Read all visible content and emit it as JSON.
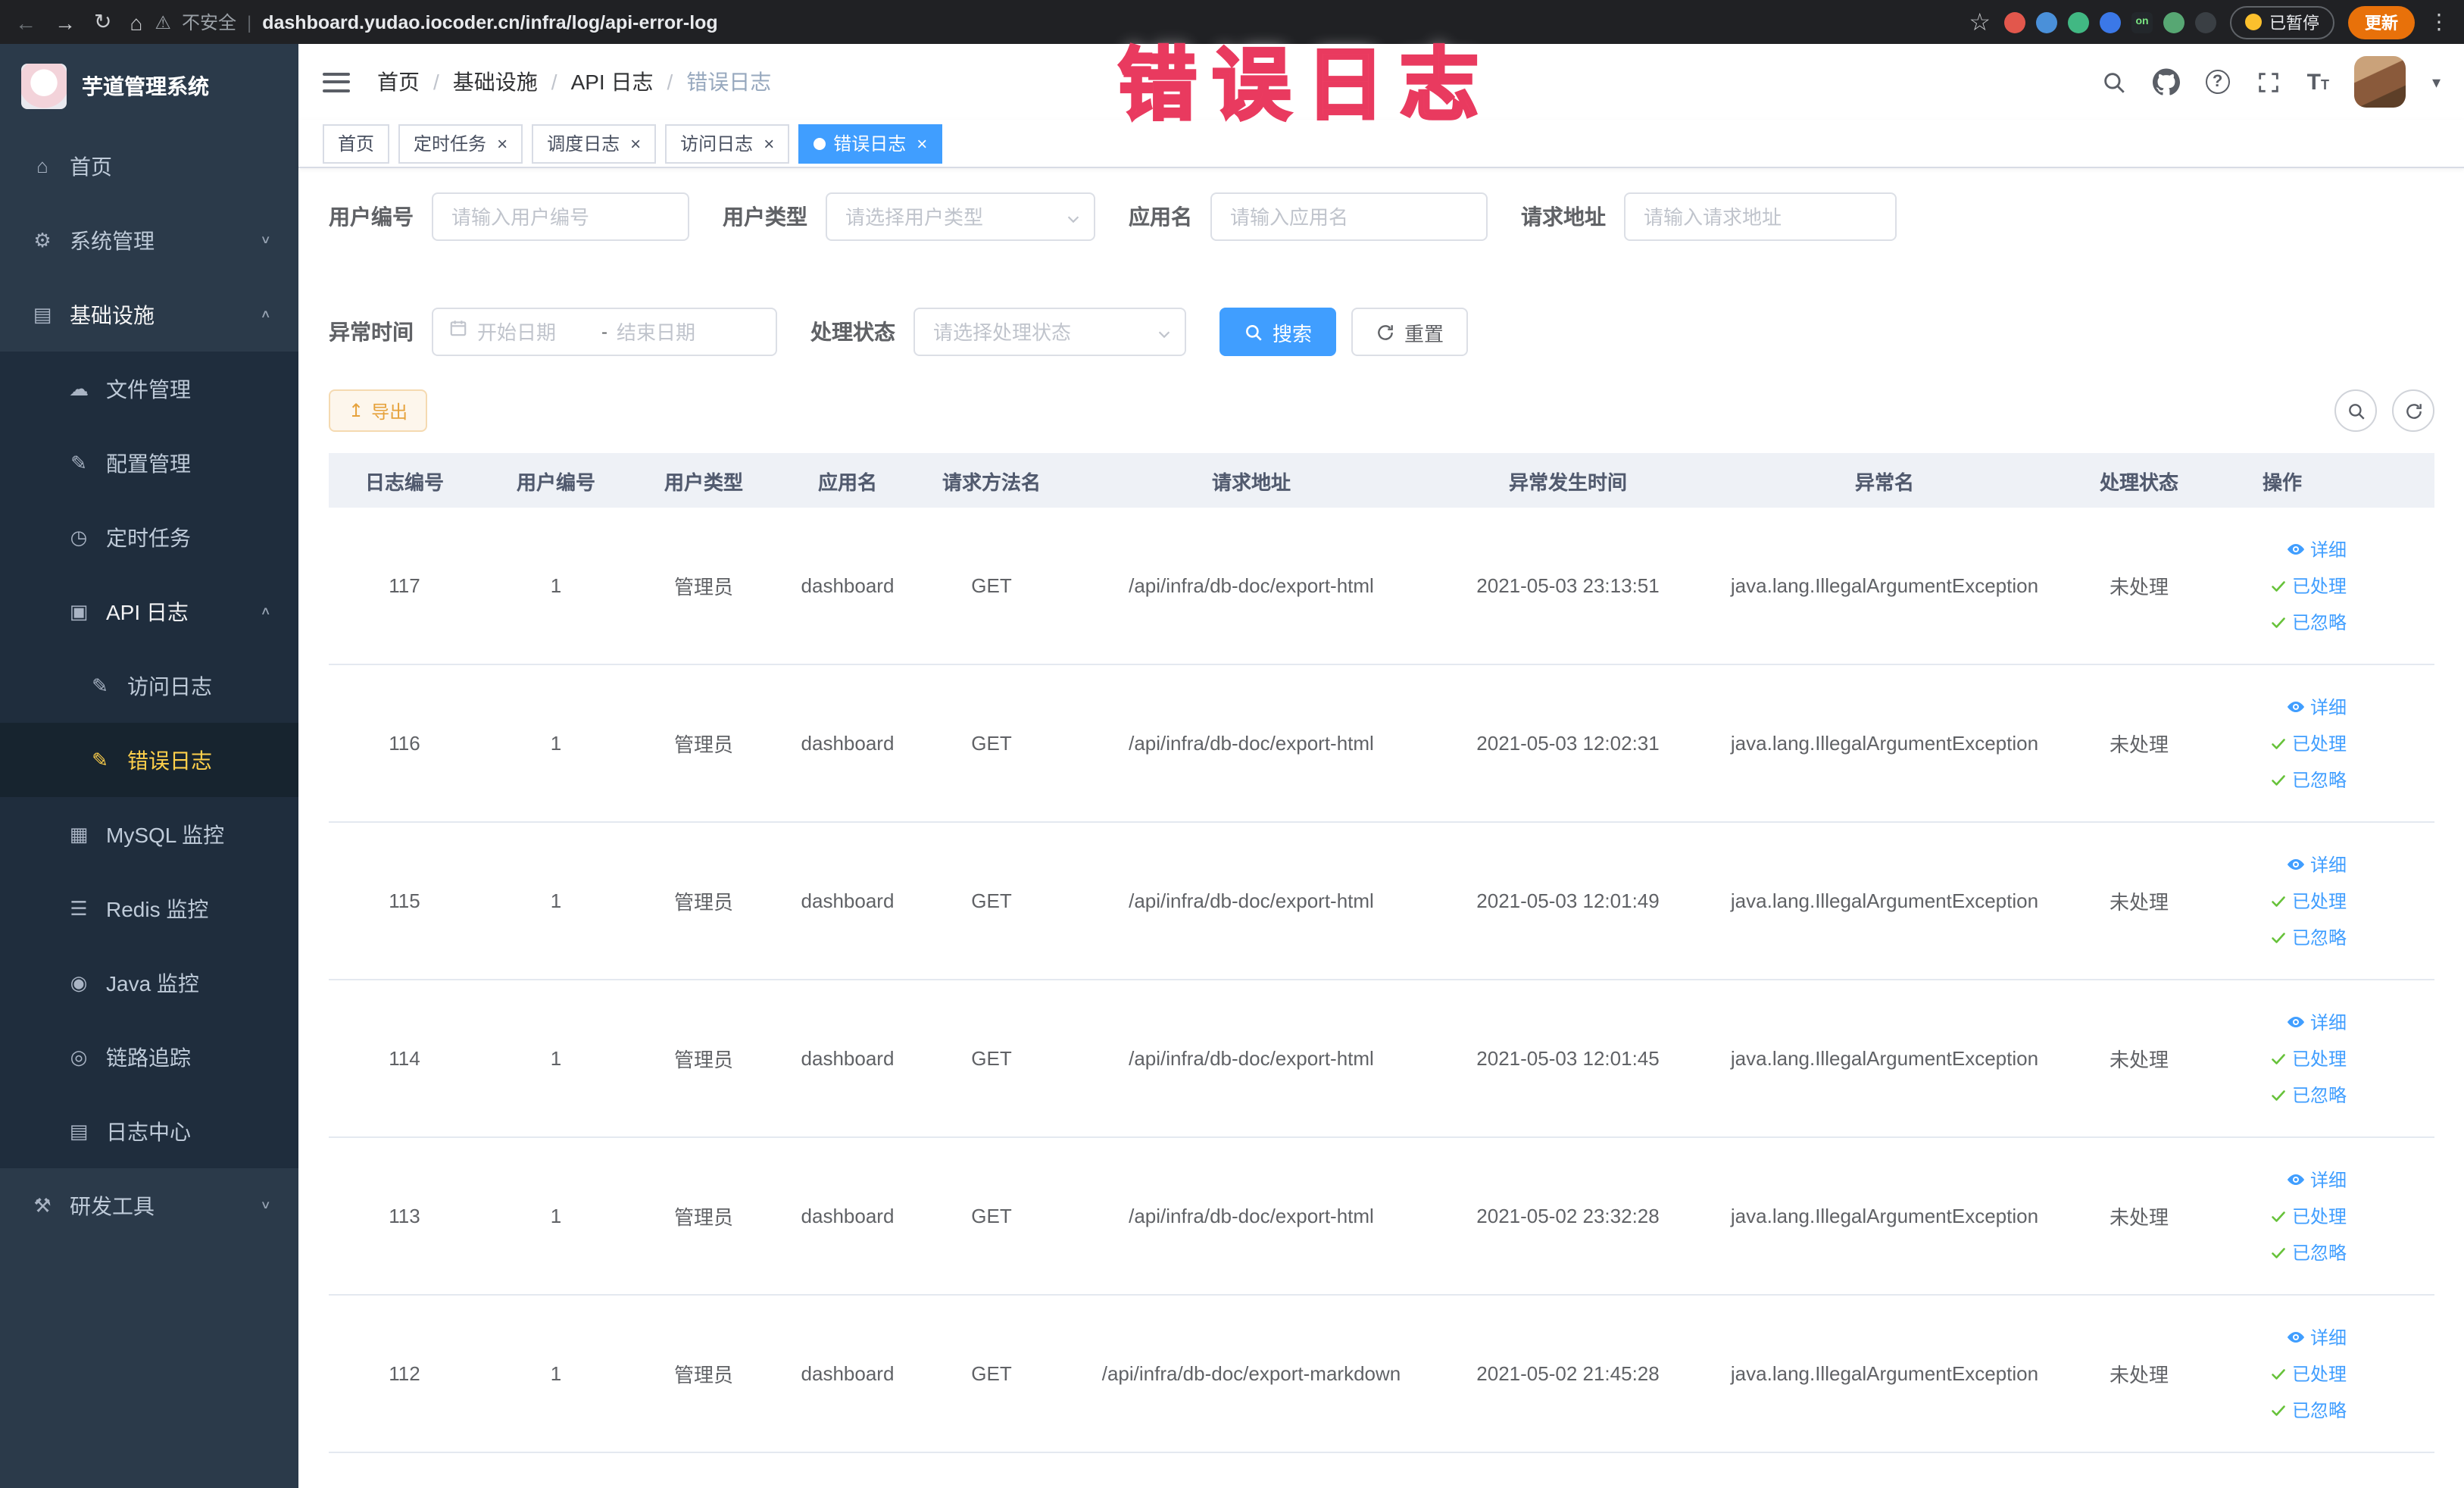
{
  "browser": {
    "security_label": "不安全",
    "url": "dashboard.yudao.iocoder.cn/infra/log/api-error-log",
    "paused_badge": "已暂停",
    "update_button": "更新",
    "icons": {
      "back": "←",
      "forward": "→",
      "reload": "↻",
      "home": "⌂",
      "warning": "⚠",
      "separator": "|",
      "star": "☆",
      "menu": "⋮",
      "caret": "▾"
    },
    "extensions": [
      {
        "name": "extension-icon-red",
        "color": "#e2574c"
      },
      {
        "name": "extension-icon-drop",
        "color": "#4a90d9"
      },
      {
        "name": "vue-devtools-icon",
        "color": "#41b883"
      },
      {
        "name": "extension-icon-blue",
        "color": "#3b78e7"
      },
      {
        "name": "proxy-on-icon",
        "color": "#23272b",
        "square": true,
        "label": "on",
        "label_color": "#7ae582"
      },
      {
        "name": "extension-icon-leaf",
        "color": "#57a773"
      },
      {
        "name": "extension-icon-paw",
        "color": "#3a3f44"
      }
    ]
  },
  "watermark": "错误日志",
  "sidebar": {
    "logo_title": "芋道管理系统",
    "menu": [
      {
        "label": "首页",
        "icon": "home-icon",
        "glyph": "⌂",
        "level": 1,
        "type": "leaf"
      },
      {
        "label": "系统管理",
        "icon": "gear-icon",
        "glyph": "⚙",
        "level": 1,
        "type": "group",
        "expanded": false
      },
      {
        "label": "基础设施",
        "icon": "infrastructure-icon",
        "glyph": "▤",
        "level": 1,
        "type": "group",
        "expanded": true,
        "active_trail": true
      },
      {
        "label": "文件管理",
        "icon": "file-manage-icon",
        "glyph": "☁",
        "level": 2,
        "type": "leaf"
      },
      {
        "label": "配置管理",
        "icon": "config-manage-icon",
        "glyph": "✎",
        "level": 2,
        "type": "leaf"
      },
      {
        "label": "定时任务",
        "icon": "scheduled-task-icon",
        "glyph": "◷",
        "level": 2,
        "type": "leaf"
      },
      {
        "label": "API 日志",
        "icon": "api-log-icon",
        "glyph": "▣",
        "level": 2,
        "type": "group",
        "expanded": true,
        "active_trail": true
      },
      {
        "label": "访问日志",
        "icon": "access-log-icon",
        "glyph": "✎",
        "level": 3,
        "type": "leaf"
      },
      {
        "label": "错误日志",
        "icon": "error-log-icon",
        "glyph": "✎",
        "level": 3,
        "type": "leaf",
        "active": true
      },
      {
        "label": "MySQL 监控",
        "icon": "mysql-monitor-icon",
        "glyph": "▦",
        "level": 2,
        "type": "leaf"
      },
      {
        "label": "Redis 监控",
        "icon": "redis-monitor-icon",
        "glyph": "☰",
        "level": 2,
        "type": "leaf"
      },
      {
        "label": "Java 监控",
        "icon": "java-monitor-icon",
        "glyph": "◉",
        "level": 2,
        "type": "leaf"
      },
      {
        "label": "链路追踪",
        "icon": "trace-icon",
        "glyph": "◎",
        "level": 2,
        "type": "leaf"
      },
      {
        "label": "日志中心",
        "icon": "log-center-icon",
        "glyph": "▤",
        "level": 2,
        "type": "leaf"
      },
      {
        "label": "研发工具",
        "icon": "dev-tools-icon",
        "glyph": "⚒",
        "level": 1,
        "type": "group",
        "expanded": false
      }
    ]
  },
  "header": {
    "breadcrumb": [
      {
        "label": "首页"
      },
      {
        "label": "基础设施"
      },
      {
        "label": "API 日志"
      },
      {
        "label": "错误日志",
        "current": true
      }
    ]
  },
  "tags_view": [
    {
      "label": "首页",
      "closable": false,
      "active": false
    },
    {
      "label": "定时任务",
      "closable": true,
      "active": false
    },
    {
      "label": "调度日志",
      "closable": true,
      "active": false
    },
    {
      "label": "访问日志",
      "closable": true,
      "active": false
    },
    {
      "label": "错误日志",
      "closable": true,
      "active": true
    }
  ],
  "filters": {
    "user_id_label": "用户编号",
    "user_id_placeholder": "请输入用户编号",
    "user_type_label": "用户类型",
    "user_type_placeholder": "请选择用户类型",
    "app_name_label": "应用名",
    "app_name_placeholder": "请输入应用名",
    "request_url_label": "请求地址",
    "request_url_placeholder": "请输入请求地址",
    "exception_time_label": "异常时间",
    "date_start_placeholder": "开始日期",
    "date_separator": "-",
    "date_end_placeholder": "结束日期",
    "process_status_label": "处理状态",
    "process_status_placeholder": "请选择处理状态",
    "search_button": "搜索",
    "reset_button": "重置"
  },
  "toolbar": {
    "export_button": "导出"
  },
  "table": {
    "columns": [
      "日志编号",
      "用户编号",
      "用户类型",
      "应用名",
      "请求方法名",
      "请求地址",
      "异常发生时间",
      "异常名",
      "处理状态",
      "操作"
    ],
    "action_labels": {
      "detail": "详细",
      "processed": "已处理",
      "ignored": "已忽略"
    },
    "rows": [
      {
        "log_id": "117",
        "user_id": "1",
        "user_type": "管理员",
        "app_name": "dashboard",
        "method": "GET",
        "request_url": "/api/infra/db-doc/export-html",
        "time": "2021-05-03 23:13:51",
        "exception": "java.lang.IllegalArgumentException",
        "status": "未处理"
      },
      {
        "log_id": "116",
        "user_id": "1",
        "user_type": "管理员",
        "app_name": "dashboard",
        "method": "GET",
        "request_url": "/api/infra/db-doc/export-html",
        "time": "2021-05-03 12:02:31",
        "exception": "java.lang.IllegalArgumentException",
        "status": "未处理"
      },
      {
        "log_id": "115",
        "user_id": "1",
        "user_type": "管理员",
        "app_name": "dashboard",
        "method": "GET",
        "request_url": "/api/infra/db-doc/export-html",
        "time": "2021-05-03 12:01:49",
        "exception": "java.lang.IllegalArgumentException",
        "status": "未处理"
      },
      {
        "log_id": "114",
        "user_id": "1",
        "user_type": "管理员",
        "app_name": "dashboard",
        "method": "GET",
        "request_url": "/api/infra/db-doc/export-html",
        "time": "2021-05-03 12:01:45",
        "exception": "java.lang.IllegalArgumentException",
        "status": "未处理"
      },
      {
        "log_id": "113",
        "user_id": "1",
        "user_type": "管理员",
        "app_name": "dashboard",
        "method": "GET",
        "request_url": "/api/infra/db-doc/export-html",
        "time": "2021-05-02 23:32:28",
        "exception": "java.lang.IllegalArgumentException",
        "status": "未处理"
      },
      {
        "log_id": "112",
        "user_id": "1",
        "user_type": "管理员",
        "app_name": "dashboard",
        "method": "GET",
        "request_url": "/api/infra/db-doc/export-markdown",
        "time": "2021-05-02 21:45:28",
        "exception": "java.lang.IllegalArgumentException",
        "status": "未处理"
      }
    ]
  },
  "colors": {
    "primary": "#409eff",
    "sidebar_bg": "#2b3a4a",
    "sidebar_submenu_bg": "#1f2d3d",
    "sidebar_active_text": "#ffd04b",
    "warning_button_text": "#e6a23c",
    "table_header_bg": "#eef1f6",
    "watermark": "#ee3f63",
    "tab_active_bg": "#409eff"
  }
}
